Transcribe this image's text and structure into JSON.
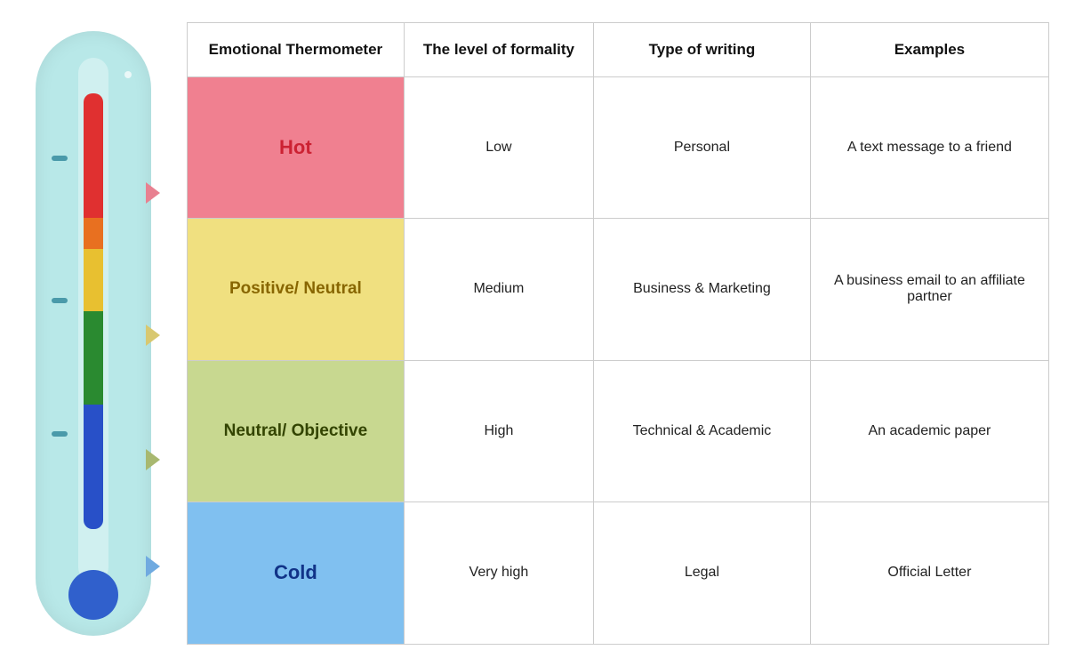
{
  "thermometer": {
    "alt": "Emotional Thermometer illustration"
  },
  "table": {
    "headers": {
      "col1": "Emotional Thermometer",
      "col2": "The level of formality",
      "col3": "Type of writing",
      "col4": "Examples"
    },
    "rows": [
      {
        "level": "Hot",
        "formality": "Low",
        "type": "Personal",
        "example": "A text message to a friend",
        "rowClass": "row-hot",
        "levelClass": "cell-hot"
      },
      {
        "level": "Positive/ Neutral",
        "formality": "Medium",
        "type": "Business & Marketing",
        "example": "A business email to an affiliate partner",
        "rowClass": "row-pos",
        "levelClass": "cell-posneutral"
      },
      {
        "level": "Neutral/ Objective",
        "formality": "High",
        "type": "Technical & Academic",
        "example": "An academic paper",
        "rowClass": "row-neutral",
        "levelClass": "cell-neutral-obj"
      },
      {
        "level": "Cold",
        "formality": "Very high",
        "type": "Legal",
        "example": "Official Letter",
        "rowClass": "row-cold",
        "levelClass": "cell-cold"
      }
    ]
  }
}
